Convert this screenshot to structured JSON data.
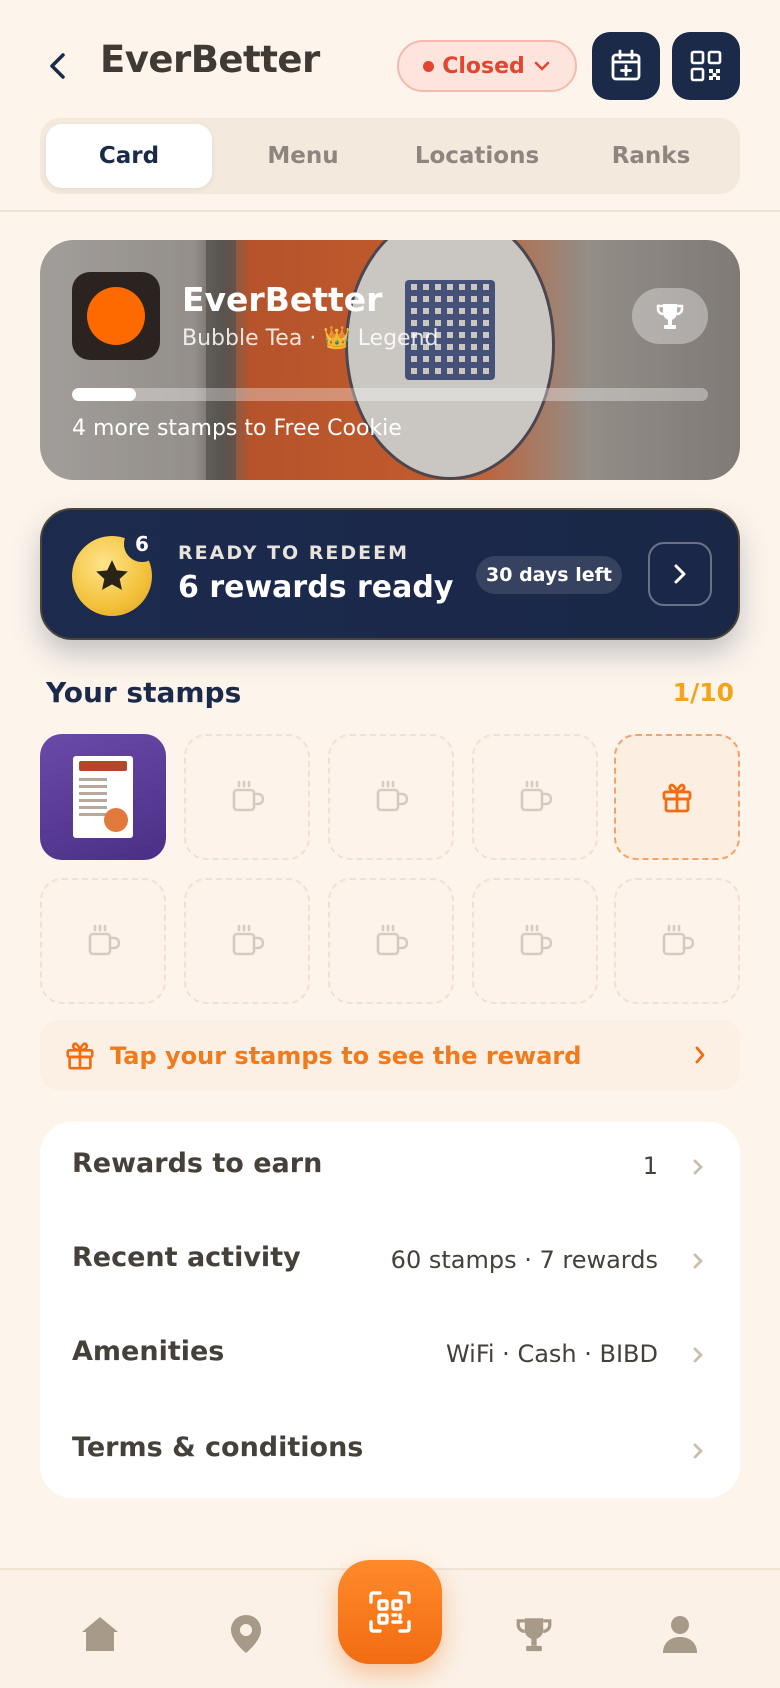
{
  "header": {
    "title": "EverBetter",
    "status_label": "Closed"
  },
  "tabs": [
    {
      "label": "Card",
      "active": true
    },
    {
      "label": "Menu",
      "active": false
    },
    {
      "label": "Locations",
      "active": false
    },
    {
      "label": "Ranks",
      "active": false
    }
  ],
  "hero": {
    "name": "EverBetter",
    "subtitle": "Bubble Tea · 👑 Legend",
    "progress_fraction": 0.1,
    "progress_text": "4 more stamps to Free Cookie"
  },
  "redeem": {
    "badge_count": "6",
    "kicker": "READY TO REDEEM",
    "title": "6 rewards ready",
    "days_left": "30 days left"
  },
  "stamps": {
    "title": "Your stamps",
    "count": "1/10",
    "hint": "Tap your stamps to see the reward"
  },
  "info": {
    "rows": [
      {
        "label": "Rewards to earn",
        "value": "1"
      },
      {
        "label": "Recent activity",
        "value": "60 stamps · 7 rewards"
      },
      {
        "label": "Amenities",
        "value": "WiFi · Cash · BIBD"
      },
      {
        "label": "Terms & conditions",
        "value": ""
      }
    ]
  },
  "colors": {
    "navy": "#1c2a4a",
    "accent_orange": "#f26c12",
    "closed_red": "#e2462f",
    "gold": "#f2a51a"
  }
}
